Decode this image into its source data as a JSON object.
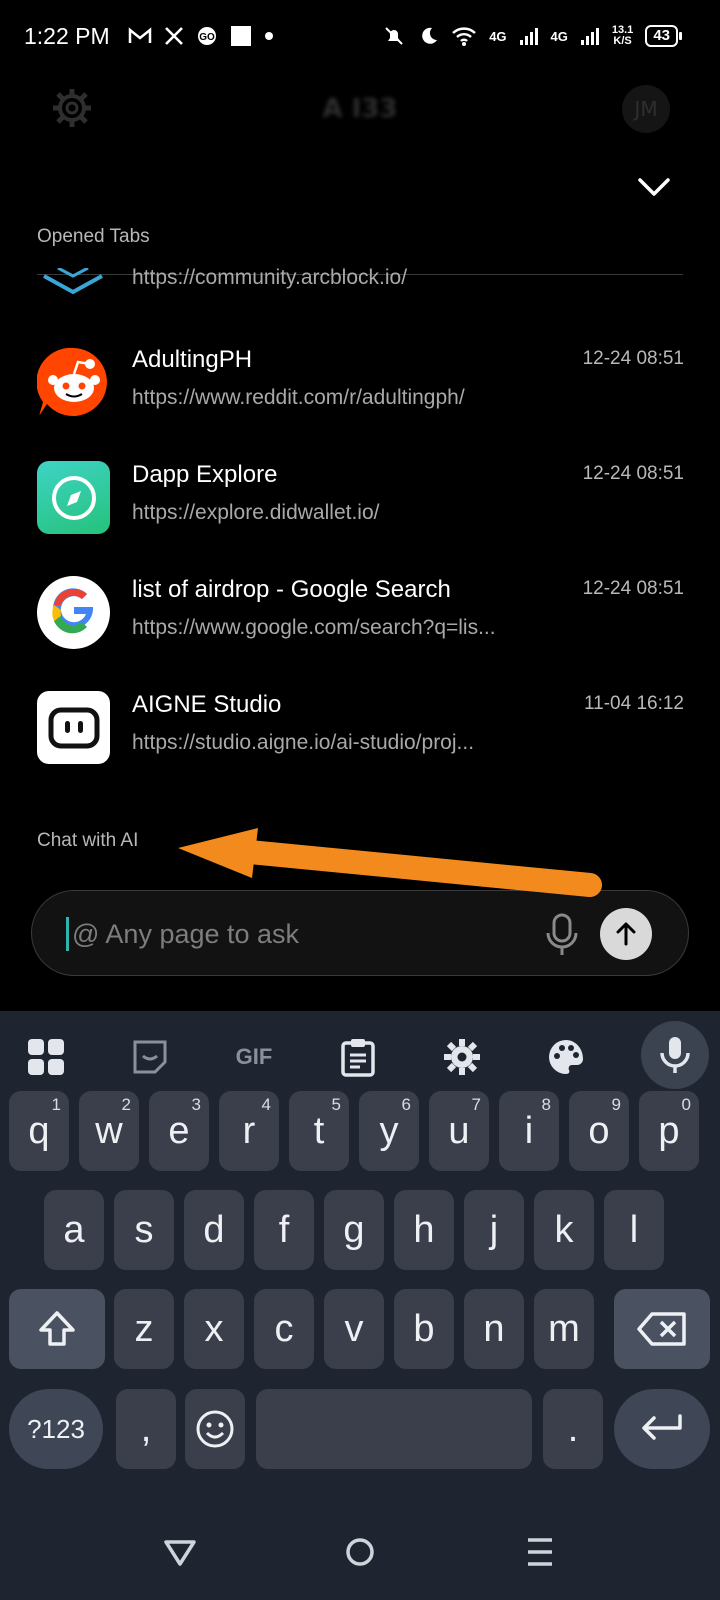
{
  "status_bar": {
    "time": "1:22 PM",
    "left_icons": [
      "gmail-icon",
      "x-icon",
      "cookie-icon",
      "square-icon",
      "dot-icon"
    ],
    "network_1": "4G",
    "network_2": "4G",
    "speed_value": "13.1",
    "speed_unit": "K/S",
    "battery": "43"
  },
  "header": {
    "title": "A I33",
    "avatar_initials": "JM"
  },
  "opened_tabs": {
    "label": "Opened Tabs",
    "partial_url": "https://community.arcblock.io/",
    "items": [
      {
        "name": "AdultingPH",
        "url": "https://www.reddit.com/r/adultingph/",
        "time": "12-24 08:51",
        "icon": "reddit-icon"
      },
      {
        "name": "Dapp Explore",
        "url": "https://explore.didwallet.io/",
        "time": "12-24 08:51",
        "icon": "compass-icon"
      },
      {
        "name": "list of airdrop - Google Search",
        "url": "https://www.google.com/search?q=lis...",
        "time": "12-24 08:51",
        "icon": "google-icon"
      },
      {
        "name": "AIGNE Studio",
        "url": "https://studio.aigne.io/ai-studio/proj...",
        "time": "11-04 16:12",
        "icon": "aigne-icon"
      }
    ]
  },
  "chat": {
    "label": "Chat with AI",
    "placeholder": "@ Any page to ask"
  },
  "keyboard": {
    "toolbar_gif": "GIF",
    "row1": [
      {
        "k": "q",
        "n": "1"
      },
      {
        "k": "w",
        "n": "2"
      },
      {
        "k": "e",
        "n": "3"
      },
      {
        "k": "r",
        "n": "4"
      },
      {
        "k": "t",
        "n": "5"
      },
      {
        "k": "y",
        "n": "6"
      },
      {
        "k": "u",
        "n": "7"
      },
      {
        "k": "i",
        "n": "8"
      },
      {
        "k": "o",
        "n": "9"
      },
      {
        "k": "p",
        "n": "0"
      }
    ],
    "row2": [
      "a",
      "s",
      "d",
      "f",
      "g",
      "h",
      "j",
      "k",
      "l"
    ],
    "row3": [
      "z",
      "x",
      "c",
      "v",
      "b",
      "n",
      "m"
    ],
    "sym_label": "?123",
    "comma": ",",
    "period": "."
  },
  "colors": {
    "accent_arrow": "#f28a1d",
    "caret": "#2fb3ad",
    "keyboard_bg": "#1f2530"
  }
}
